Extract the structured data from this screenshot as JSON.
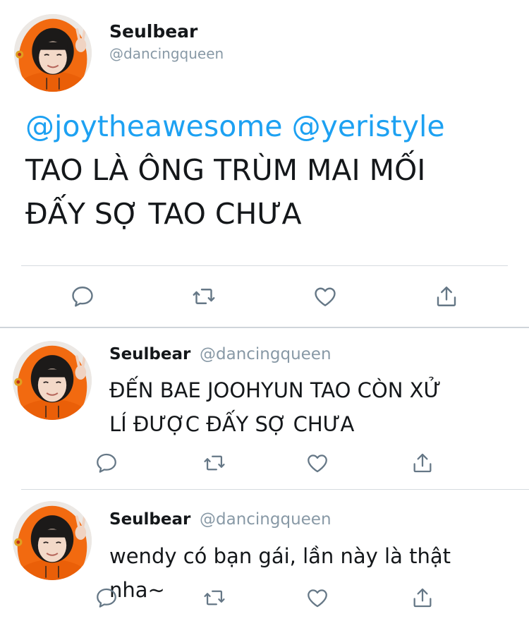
{
  "main_tweet": {
    "display_name": "Seulbear",
    "handle": "@dancingqueen",
    "mention_1": "@joytheawesome",
    "mention_2": "@yeristyle",
    "line_1": "TAO LÀ ÔNG TRÙM MAI MỐI",
    "line_2": "ĐẤY SỢ TAO CHƯA"
  },
  "replies": [
    {
      "display_name": "Seulbear",
      "handle": "@dancingqueen",
      "line_1": "ĐẾN BAE JOOHYUN TAO CÒN XỬ",
      "line_2": "LÍ ĐƯỢC ĐẤY SỢ CHƯA"
    },
    {
      "display_name": "Seulbear",
      "handle": "@dancingqueen",
      "line_1": "wendy có bạn gái, lần này là thật nha~"
    }
  ],
  "actions": [
    "reply-icon",
    "retweet-icon",
    "like-icon",
    "share-icon"
  ],
  "colors": {
    "mention": "#1da1f2",
    "handle": "#8899a6",
    "text": "#14171a",
    "hood": "#f26a10",
    "divider": "#d6dbe0"
  }
}
